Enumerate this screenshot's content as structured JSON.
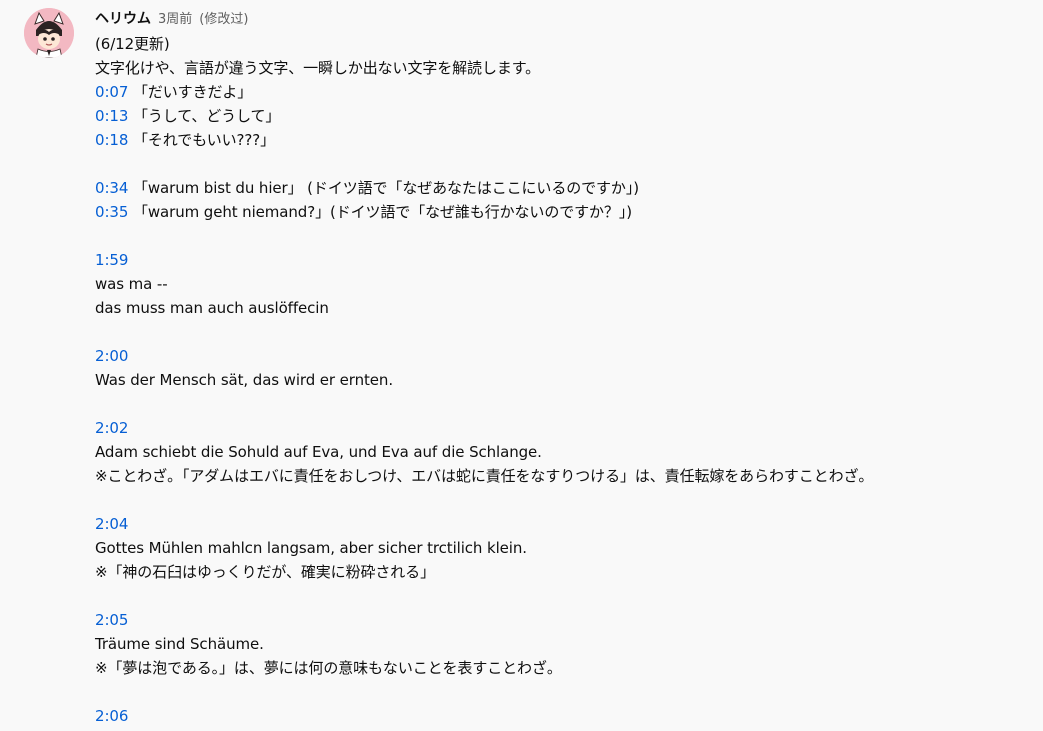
{
  "comment": {
    "author": "ヘリウム",
    "time": "3周前",
    "edited": "(修改过)",
    "lines": [
      {
        "text": "(6/12更新)"
      },
      {
        "text": "文字化けや、言語が違う文字、一瞬しか出ない文字を解読します。"
      },
      {
        "timestamp": "0:07",
        "text": " 「だいすきだよ」"
      },
      {
        "timestamp": "0:13",
        "text": " 「うして、どうして」"
      },
      {
        "timestamp": "0:18",
        "text": " 「それでもいい???」"
      },
      {
        "blank": true
      },
      {
        "timestamp": "0:34",
        "text": " 「warum bist du hier」 (ドイツ語で「なぜあなたはここにいるのですか」)"
      },
      {
        "timestamp": "0:35",
        "text": " 「warum geht niemand?」(ドイツ語で「なぜ誰も行かないのですか？」)"
      },
      {
        "blank": true
      },
      {
        "timestamp": "1:59",
        "text": ""
      },
      {
        "text": "was ma --"
      },
      {
        "text": "das muss man auch auslöffecin"
      },
      {
        "blank": true
      },
      {
        "timestamp": "2:00",
        "text": ""
      },
      {
        "text": "Was der Mensch sät, das wird er ernten."
      },
      {
        "blank": true
      },
      {
        "timestamp": "2:02",
        "text": ""
      },
      {
        "text": "Adam schiebt die Sohuld auf Eva, und Eva auf die Schlange."
      },
      {
        "text": "※ことわざ。「アダムはエバに責任をおしつけ、エバは蛇に責任をなすりつける」は、責任転嫁をあらわすことわざ。"
      },
      {
        "blank": true
      },
      {
        "timestamp": "2:04",
        "text": ""
      },
      {
        "text": "Gottes Mühlen  mahlcn langsam, aber sicher trctilich klein."
      },
      {
        "text": "※「神の石臼はゆっくりだが、確実に粉砕される」"
      },
      {
        "blank": true
      },
      {
        "timestamp": "2:05",
        "text": ""
      },
      {
        "text": "Träume sind Schäume."
      },
      {
        "text": "※「夢は泡である。」は、夢には何の意味もないことを表すことわざ。"
      },
      {
        "blank": true
      },
      {
        "timestamp": "2:06",
        "text": ""
      }
    ]
  },
  "colors": {
    "background": "#f9f9f9",
    "timestamp_link": "#065fd4",
    "meta_text": "#606060",
    "avatar_bg": "#f3b8c2"
  },
  "icons": {
    "avatar": "cartoon-character-avatar"
  }
}
